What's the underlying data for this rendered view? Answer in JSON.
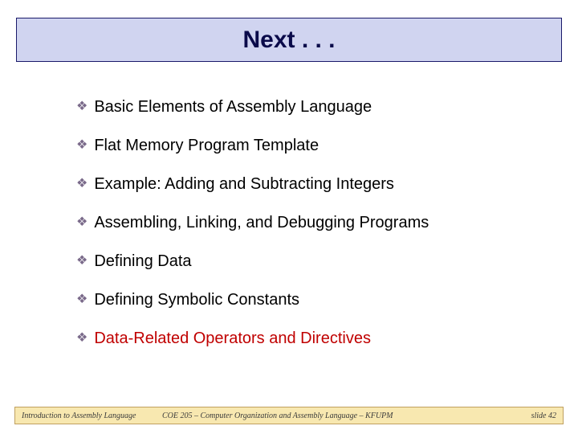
{
  "title": "Next . . .",
  "bullets": [
    {
      "text": "Basic Elements of Assembly Language",
      "highlight": false
    },
    {
      "text": "Flat Memory Program Template",
      "highlight": false
    },
    {
      "text": "Example: Adding and Subtracting Integers",
      "highlight": false
    },
    {
      "text": "Assembling, Linking, and Debugging Programs",
      "highlight": false
    },
    {
      "text": "Defining Data",
      "highlight": false
    },
    {
      "text": "Defining Symbolic Constants",
      "highlight": false
    },
    {
      "text": "Data-Related Operators and Directives",
      "highlight": true
    }
  ],
  "footer": {
    "left": "Introduction to Assembly Language",
    "center": "COE 205 – Computer Organization and Assembly Language – KFUPM",
    "right": "slide 42"
  },
  "bullet_glyph": "❖"
}
